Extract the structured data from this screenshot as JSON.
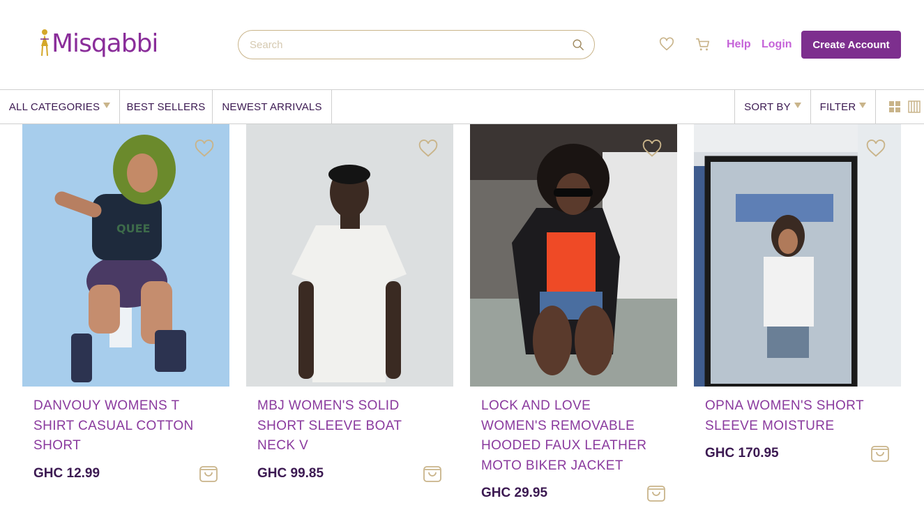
{
  "brand": {
    "name": "Misqabbi",
    "accent": "#7d2f8e",
    "gold": "#c9b48a"
  },
  "search": {
    "placeholder": "Search",
    "value": "",
    "icon": "search-icon"
  },
  "header": {
    "wishlist_icon": "heart-icon",
    "cart_icon": "cart-icon",
    "help_label": "Help",
    "login_label": "Login",
    "create_account_label": "Create Account"
  },
  "nav": {
    "all_categories": "ALL CATEGORIES",
    "best_sellers": "BEST SELLERS",
    "newest_arrivals": "NEWEST ARRIVALS",
    "sort_by": "SORT BY",
    "filter": "FILTER",
    "grid_view_icon": "grid-view-icon",
    "column_view_icon": "column-view-icon"
  },
  "products": [
    {
      "name": "DANVOUY WOMENS T SHIRT CASUAL COTTON SHORT",
      "price": "GHC 12.99"
    },
    {
      "name": "MBJ WOMEN'S SOLID SHORT SLEEVE BOAT NECK V",
      "price": "GHC 99.85"
    },
    {
      "name": "LOCK AND LOVE WOMEN'S REMOVABLE HOODED FAUX LEATHER MOTO BIKER JACKET",
      "price": "GHC 29.95"
    },
    {
      "name": "OPNA WOMEN'S SHORT SLEEVE MOISTURE",
      "price": "GHC 170.95"
    }
  ]
}
